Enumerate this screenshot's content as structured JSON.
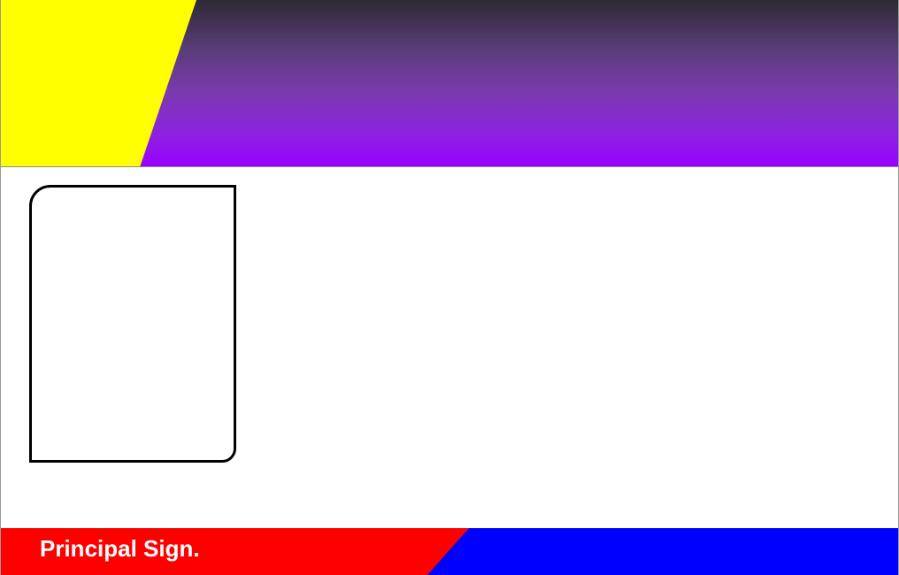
{
  "card": {
    "colors": {
      "header_yellow": "#ffff00",
      "header_gradient_top": "#2e2a34",
      "header_gradient_bottom": "#9900ff",
      "footer_red": "#ff0000",
      "footer_blue": "#0000ff",
      "photo_border": "#000000",
      "label_text": "#ffffff"
    },
    "footer": {
      "sign_label": "Principal Sign."
    }
  }
}
